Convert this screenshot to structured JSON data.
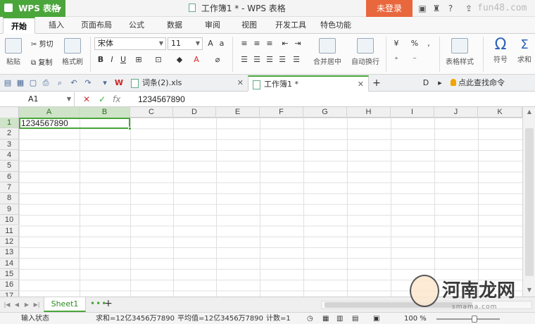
{
  "titlebar": {
    "app_name": "WPS 表格",
    "document_title": "工作簿1 * - WPS 表格",
    "login": "未登录",
    "watermark_url": "fun48.com"
  },
  "ribbon_tabs": [
    "开始",
    "插入",
    "页面布局",
    "公式",
    "数据",
    "审阅",
    "视图",
    "开发工具",
    "特色功能"
  ],
  "ribbon": {
    "paste": "粘贴",
    "cut": "剪切",
    "copy": "复制",
    "format_painter": "格式刷",
    "font_name": "宋体",
    "font_size": "11",
    "merge_center": "合并居中",
    "auto_wrap": "自动换行",
    "table_style": "表格样式",
    "symbol": "符号",
    "sum": "求和",
    "percent": "%",
    "bold": "B",
    "italic": "I",
    "underline": "U"
  },
  "doc_tabs": [
    {
      "name": "词条(2).xls",
      "active": false
    },
    {
      "name": "工作簿1 *",
      "active": true
    }
  ],
  "find_command": "点此查找命令 (Alt+Q)",
  "formula_bar": {
    "cell_ref": "A1",
    "fx": "fx",
    "content": "1234567890"
  },
  "columns": [
    "A",
    "B",
    "C",
    "D",
    "E",
    "F",
    "G",
    "H",
    "I",
    "J",
    "K"
  ],
  "rows": [
    "1",
    "2",
    "3",
    "4",
    "5",
    "6",
    "7",
    "8",
    "9",
    "10",
    "11",
    "12",
    "13",
    "14",
    "15",
    "16",
    "17"
  ],
  "cells": {
    "A1": "1234567890"
  },
  "sheets": [
    "Sheet1"
  ],
  "status": {
    "mode": "输入状态",
    "sum": "求和=12亿3456万7890",
    "avg": "平均值=12亿3456万7890",
    "count": "计数=1",
    "zoom": "100 %"
  },
  "watermark": {
    "text": "河南龙网",
    "sub": "smama.com"
  },
  "colors": {
    "accent": "#4aa63b",
    "login": "#e8673d"
  }
}
